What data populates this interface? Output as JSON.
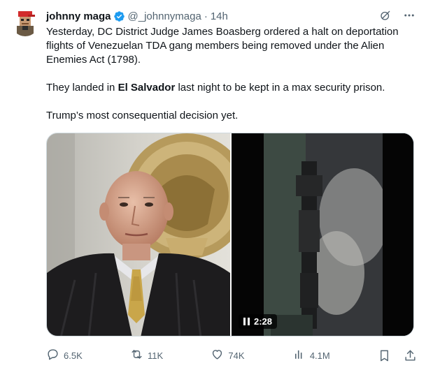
{
  "author": {
    "name": "johnny maga",
    "handle": "@_johnnymaga",
    "time": "14h"
  },
  "tweet": {
    "line1": "Yesterday, DC District Judge James Boasberg ordered a halt on deportation flights of Venezuelan TDA gang members being removed under the Alien Enemies Act (1798).",
    "line2_pre": "They landed in ",
    "line2_bold": "El Salvador",
    "line2_post": " last night to be kept in a max security prison.",
    "line3": "Trump’s most consequential decision yet."
  },
  "video": {
    "duration": "2:28"
  },
  "metrics": {
    "replies": "6.5K",
    "reposts": "11K",
    "likes": "74K",
    "views": "4.1M"
  },
  "icons": {
    "verified": "verified-badge-icon",
    "grok": "grok-icon",
    "more": "more-icon",
    "reply": "reply-icon",
    "repost": "repost-icon",
    "like": "heart-icon",
    "views": "views-icon",
    "bookmark": "bookmark-icon",
    "share": "share-icon",
    "pause": "pause-icon"
  },
  "colors": {
    "text": "#0f1419",
    "secondary": "#536471",
    "verified": "#1d9bf0",
    "border": "#cfd9de"
  }
}
